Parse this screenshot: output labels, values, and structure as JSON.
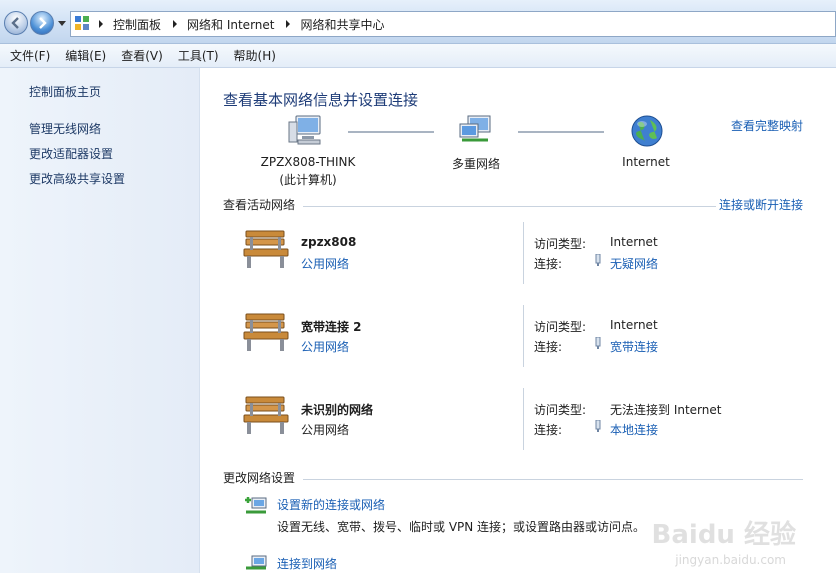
{
  "address": {
    "crumbs": [
      "控制面板",
      "网络和 Internet",
      "网络和共享中心"
    ]
  },
  "menu": [
    "文件(F)",
    "编辑(E)",
    "查看(V)",
    "工具(T)",
    "帮助(H)"
  ],
  "sidebar": {
    "home": "控制面板主页",
    "items": [
      "管理无线网络",
      "更改适配器设置",
      "更改高级共享设置"
    ]
  },
  "main": {
    "title": "查看基本网络信息并设置连接",
    "full_map": "查看完整映射",
    "map": {
      "computer_line1": "ZPZX808-THINK",
      "computer_line2": "(此计算机)",
      "multi": "多重网络",
      "internet": "Internet"
    },
    "active_section": "查看活动网络",
    "connect_disconnect": "连接或断开连接",
    "access_type_label": "访问类型:",
    "connection_label": "连接:",
    "networks": [
      {
        "name": "zpzx808",
        "category": "公用网络",
        "access": "Internet",
        "connection": "无疑网络"
      },
      {
        "name": "宽带连接  2",
        "category": "公用网络",
        "access": "Internet",
        "connection": "宽带连接"
      },
      {
        "name": "未识别的网络",
        "category": "公用网络",
        "access": "无法连接到 Internet",
        "connection": "本地连接"
      }
    ],
    "change_section": "更改网络设置",
    "tasks": [
      {
        "label": "设置新的连接或网络",
        "desc": "设置无线、宽带、拨号、临时或 VPN 连接；或设置路由器或访问点。"
      },
      {
        "label": "连接到网络"
      }
    ]
  },
  "watermark": {
    "line1": "Baidu 经验",
    "line2": "jingyan.baidu.com"
  }
}
